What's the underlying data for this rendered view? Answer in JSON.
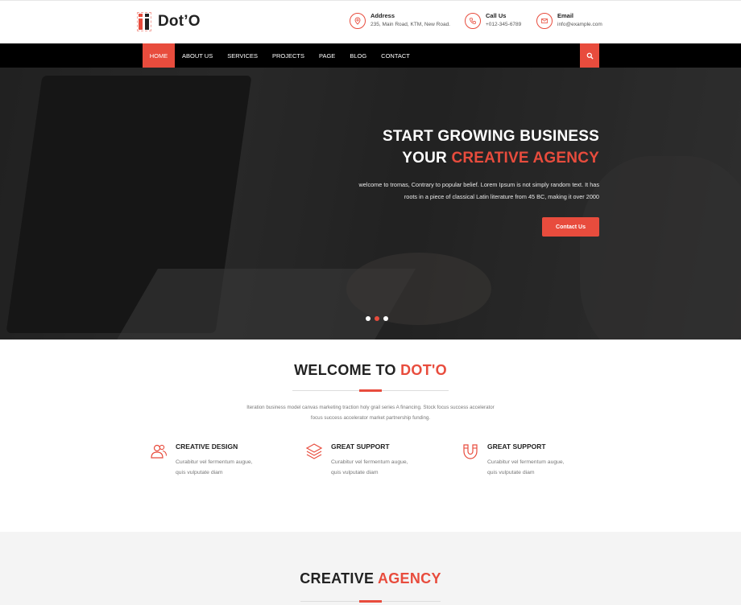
{
  "brand": {
    "name": "Dot’O"
  },
  "contacts": [
    {
      "icon": "map-pin-icon",
      "title": "Address",
      "value": "235, Main Road, KTM, New Road."
    },
    {
      "icon": "phone-icon",
      "title": "Call Us",
      "value": "+012-345-6789"
    },
    {
      "icon": "envelope-icon",
      "title": "Email",
      "value": "info@example.com"
    }
  ],
  "nav": {
    "items": [
      "HOME",
      "ABOUT US",
      "SERVICES",
      "PROJECTS",
      "PAGE",
      "BLOG",
      "CONTACT"
    ],
    "active_index": 0
  },
  "hero": {
    "title_line1": "START GROWING BUSINESS",
    "title_line2_plain": "YOUR ",
    "title_line2_accent": "CREATIVE AGENCY",
    "desc_line1": "welcome to tromas, Contrary to popular belief. Lorem Ipsum is not simply random text. It has",
    "desc_line2": "roots in a piece of classical Latin literature from 45 BC, making it over 2000",
    "button": "Contact Us",
    "slides": 3,
    "active_slide": 1
  },
  "welcome": {
    "title_plain": "WELCOME TO ",
    "title_accent": "DOT'O",
    "desc_line1": "Iteration business model canvas marketing traction holy grail series A financing. Stock focus success accelerator",
    "desc_line2": "focus success accelerator market partnership funding.",
    "features": [
      {
        "icon": "users-icon",
        "title": "CREATIVE DESIGN",
        "line1": "Curabitur vel fermentum augue,",
        "line2": "quis vulputate diam"
      },
      {
        "icon": "layers-icon",
        "title": "GREAT SUPPORT",
        "line1": "Curabitur vel fermentum augue,",
        "line2": "quis vulputate diam"
      },
      {
        "icon": "magnet-icon",
        "title": "GREAT SUPPORT",
        "line1": "Curabitur vel fermentum augue,",
        "line2": "quis vulputate diam"
      }
    ]
  },
  "agency": {
    "title_plain": "CREATIVE ",
    "title_accent": "AGENCY"
  },
  "colors": {
    "accent": "#e84c3d",
    "nav_bg": "#000000",
    "section_gray": "#f4f4f4"
  }
}
